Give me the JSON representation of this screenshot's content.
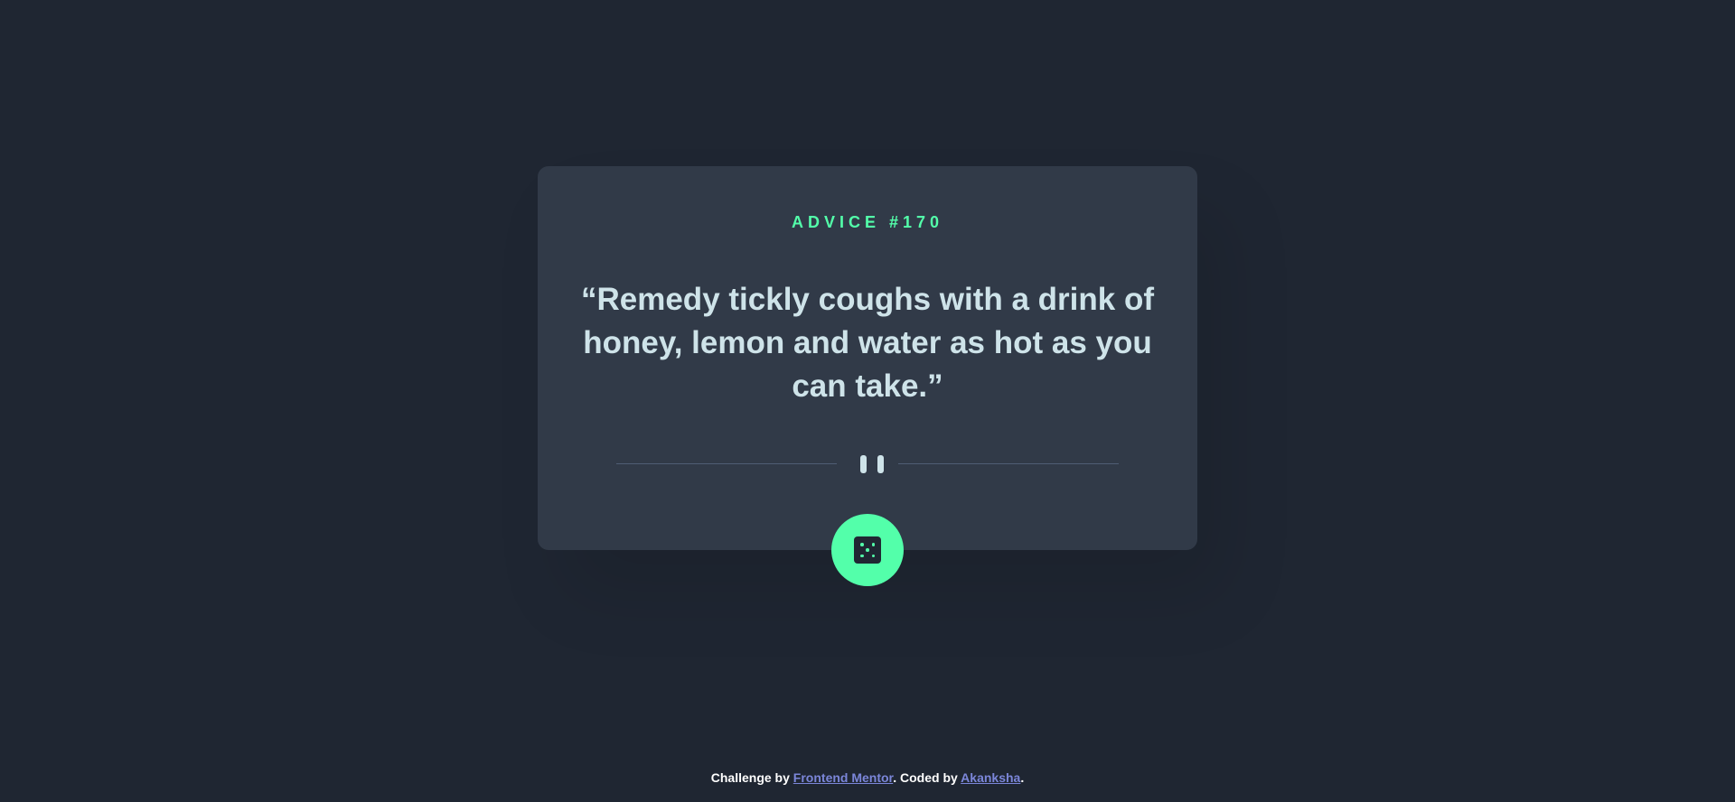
{
  "card": {
    "advice_label": "ADVICE #170",
    "quote": "“Remedy tickly coughs with a drink of honey, lemon and water as hot as you can take.”"
  },
  "icons": {
    "divider": "pause-icon",
    "button": "dice-icon"
  },
  "footer": {
    "prefix": "Challenge by ",
    "link1": "Frontend Mentor",
    "middle": ". Coded by ",
    "link2": "Akanksha",
    "suffix": "."
  },
  "colors": {
    "background": "#1f2632",
    "card": "#313a48",
    "accent": "#53ffaa",
    "quote_text": "#cee3e9",
    "link": "#7b86d9"
  }
}
